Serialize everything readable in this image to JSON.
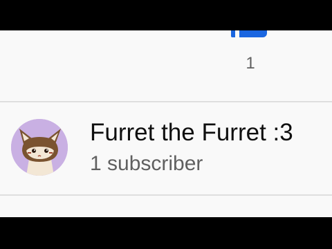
{
  "like": {
    "icon": "thumbs-up-icon",
    "count": "1"
  },
  "channel": {
    "avatar_icon": "furret-avatar",
    "name": "Furret the Furret :3",
    "subscribers": "1 subscriber"
  },
  "colors": {
    "accent": "#1a66e0",
    "background": "#f9f9f9",
    "text_primary": "#0f0f0f",
    "text_secondary": "#606060",
    "avatar_bg": "#c9b0e3"
  }
}
